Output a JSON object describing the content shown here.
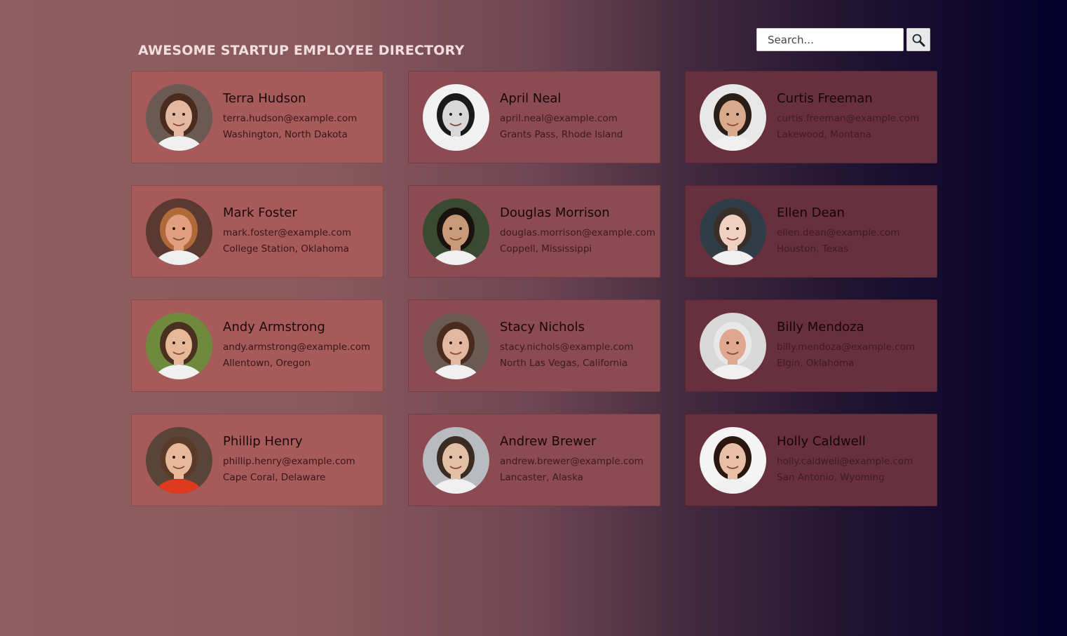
{
  "header": {
    "title": "AWESOME STARTUP EMPLOYEE DIRECTORY"
  },
  "search": {
    "placeholder": "Search...",
    "button_icon": "magnifier-icon"
  },
  "employees": [
    {
      "name": "Terra Hudson",
      "email": "terra.hudson@example.com",
      "location": "Washington, North Dakota",
      "avatar": {
        "bg": "#6b5a52",
        "skin": "#e2b8a0",
        "hair": "#4a2c1e"
      }
    },
    {
      "name": "April Neal",
      "email": "april.neal@example.com",
      "location": "Grants Pass, Rhode Island",
      "avatar": {
        "bg": "#f2f2f2",
        "skin": "#d8d8d8",
        "hair": "#1a1a1a"
      }
    },
    {
      "name": "Curtis Freeman",
      "email": "curtis.freeman@example.com",
      "location": "Lakewood, Montana",
      "avatar": {
        "bg": "#e8e8e8",
        "skin": "#d9aa8c",
        "hair": "#2a1e18"
      }
    },
    {
      "name": "Mark Foster",
      "email": "mark.foster@example.com",
      "location": "College Station, Oklahoma",
      "avatar": {
        "bg": "#5a3a30",
        "skin": "#e0a080",
        "hair": "#b06a3a"
      }
    },
    {
      "name": "Douglas Morrison",
      "email": "douglas.morrison@example.com",
      "location": "Coppell, Mississippi",
      "avatar": {
        "bg": "#3a4a30",
        "skin": "#c99a78",
        "hair": "#1a120e"
      }
    },
    {
      "name": "Ellen Dean",
      "email": "ellen.dean@example.com",
      "location": "Houston, Texas",
      "avatar": {
        "bg": "#2e3d46",
        "skin": "#f0d0c0",
        "hair": "#3a2e28"
      }
    },
    {
      "name": "Andy Armstrong",
      "email": "andy.armstrong@example.com",
      "location": "Allentown, Oregon",
      "avatar": {
        "bg": "#6e8a3c",
        "skin": "#e6b898",
        "hair": "#4a3020"
      }
    },
    {
      "name": "Stacy Nichols",
      "email": "stacy.nichols@example.com",
      "location": "North Las Vegas, California",
      "avatar": {
        "bg": "#6b5a52",
        "skin": "#e2b8a0",
        "hair": "#4a2c1e"
      }
    },
    {
      "name": "Billy Mendoza",
      "email": "billy.mendoza@example.com",
      "location": "Elgin, Oklahoma",
      "avatar": {
        "bg": "#d8d8d8",
        "skin": "#e0a890",
        "hair": "#e8e8e8"
      }
    },
    {
      "name": "Phillip Henry",
      "email": "phillip.henry@example.com",
      "location": "Cape Coral, Delaware",
      "avatar": {
        "bg": "#5a4438",
        "skin": "#e8b89a",
        "hair": "#5a3a28",
        "shirt": "#e03a1e"
      }
    },
    {
      "name": "Andrew Brewer",
      "email": "andrew.brewer@example.com",
      "location": "Lancaster, Alaska",
      "avatar": {
        "bg": "#b8bcc0",
        "skin": "#e2c0a8",
        "hair": "#3a2c22"
      }
    },
    {
      "name": "Holly Caldwell",
      "email": "holly.caldwell@example.com",
      "location": "San Antonio, Wyoming",
      "avatar": {
        "bg": "#f4f4f4",
        "skin": "#e8c0a8",
        "hair": "#2a1810"
      }
    }
  ]
}
